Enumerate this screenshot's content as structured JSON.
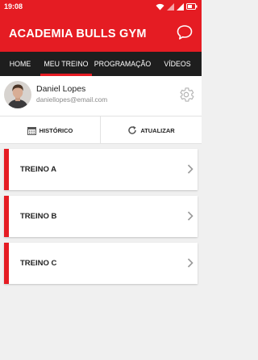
{
  "status_bar": {
    "time": "19:08"
  },
  "app_bar": {
    "title": "ACADEMIA BULLS GYM",
    "chat_icon": "chat-bubble-icon"
  },
  "tabs": [
    {
      "label": "HOME",
      "active": false
    },
    {
      "label": "MEU TREINO",
      "active": true
    },
    {
      "label": "PROGRAMAÇÃO",
      "active": false
    },
    {
      "label": "VÍDEOS",
      "active": false
    }
  ],
  "profile": {
    "name": "Daniel Lopes",
    "email": "daniellopes@email.com",
    "settings_icon": "gear-icon"
  },
  "actions": {
    "history_label": "HISTÓRICO",
    "refresh_label": "ATUALIZAR"
  },
  "workouts": [
    {
      "label": "TREINO A"
    },
    {
      "label": "TREINO B"
    },
    {
      "label": "TREINO C"
    }
  ],
  "colors": {
    "primary": "#e51c23",
    "tab_bar": "#1e1e1e",
    "background": "#f0f0f0"
  }
}
